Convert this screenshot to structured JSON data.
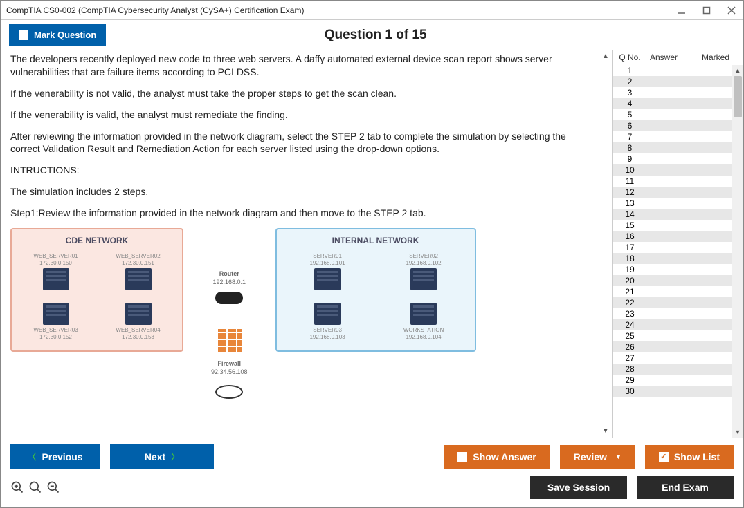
{
  "window": {
    "title": "CompTIA CS0-002 (CompTIA Cybersecurity Analyst (CySA+) Certification Exam)"
  },
  "header": {
    "mark_label": "Mark Question",
    "question_title": "Question 1 of 15"
  },
  "content": {
    "p1": "The developers recently deployed new code to three web servers. A daffy automated external device scan report shows server vulnerabilities that are failure items according to PCI DSS.",
    "p2": "If the venerability is not valid, the analyst must take the proper steps to get the scan clean.",
    "p3": "If the venerability is valid, the analyst must remediate the finding.",
    "p4": "After reviewing the information provided in the network diagram, select the STEP 2 tab to complete the simulation by selecting the correct Validation Result and Remediation Action for each server listed using the drop-down options.",
    "p5": "INTRUCTIONS:",
    "p6": "The simulation includes 2 steps.",
    "p7": "Step1:Review the information provided in the network diagram and then move to the STEP 2 tab."
  },
  "diagram": {
    "cde_title": "CDE NETWORK",
    "internal_title": "INTERNAL NETWORK",
    "router_label": "Router",
    "router_ip": "192.168.0.1",
    "firewall_label": "Firewall",
    "firewall_ip": "92.34.56.108",
    "cde_servers": [
      {
        "name": "WEB_SERVER01",
        "ip": "172.30.0.150"
      },
      {
        "name": "WEB_SERVER02",
        "ip": "172.30.0.151"
      },
      {
        "name": "WEB_SERVER03",
        "ip": "172.30.0.152"
      },
      {
        "name": "WEB_SERVER04",
        "ip": "172.30.0.153"
      }
    ],
    "internal_servers": [
      {
        "name": "SERVER01",
        "ip": "192.168.0.101"
      },
      {
        "name": "SERVER02",
        "ip": "192.168.0.102"
      },
      {
        "name": "SERVER03",
        "ip": "192.168.0.103"
      },
      {
        "name": "WORKSTATION",
        "ip": "192.168.0.104"
      }
    ]
  },
  "qlist": {
    "head_qno": "Q No.",
    "head_answer": "Answer",
    "head_marked": "Marked",
    "count": 30
  },
  "footer": {
    "previous": "Previous",
    "next": "Next",
    "show_answer": "Show Answer",
    "review": "Review",
    "show_list": "Show List",
    "save_session": "Save Session",
    "end_exam": "End Exam"
  }
}
